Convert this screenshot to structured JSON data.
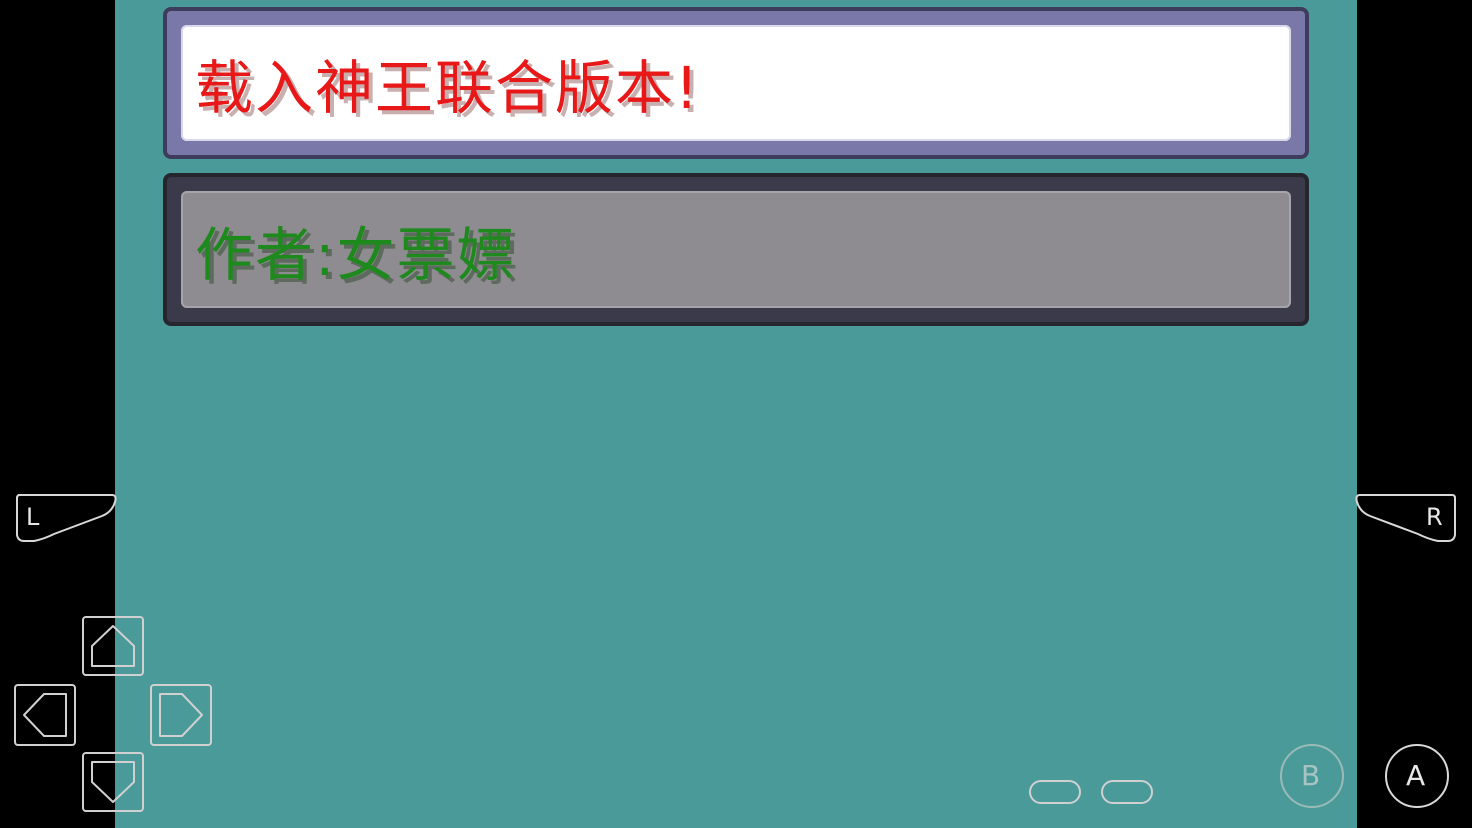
{
  "dialog": {
    "title_line": "载入神王联合版本!",
    "author_line": "作者:女票嫖"
  },
  "controls": {
    "shoulder_left": {
      "label": "L",
      "icon": "shoulder-button-left"
    },
    "shoulder_right": {
      "label": "R",
      "icon": "shoulder-button-right"
    },
    "dpad": {
      "up": "arrow-up-icon",
      "down": "arrow-down-icon",
      "left": "arrow-left-icon",
      "right": "arrow-right-icon"
    },
    "select": {
      "icon": "select-pill-button"
    },
    "start": {
      "icon": "start-pill-button"
    },
    "button_b": {
      "label": "B"
    },
    "button_a": {
      "label": "A"
    }
  },
  "colors": {
    "screen_background": "#4a9a9a",
    "title_text": "#e81818",
    "author_text": "#1e8a1e",
    "title_box_frame": "#7a78a8",
    "author_box_frame": "#3a3a4a",
    "author_box_fill": "#8e8c90",
    "letterbox": "#000000"
  }
}
